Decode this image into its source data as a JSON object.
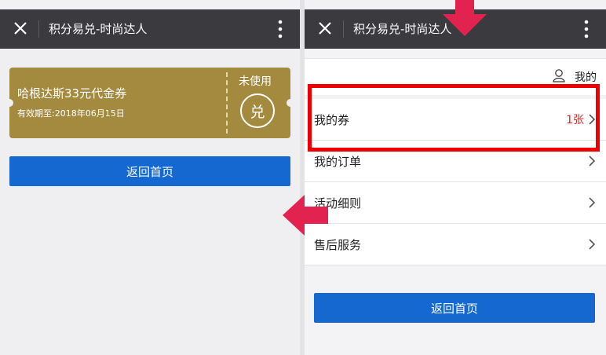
{
  "left": {
    "header": {
      "title": "积分易兑-时尚达人"
    },
    "coupon": {
      "title": "哈根达斯33元代金券",
      "expiry": "有效期至:2018年06月15日",
      "status": "未使用",
      "stamp": "兑"
    },
    "home_button": "返回首页"
  },
  "right": {
    "header": {
      "title": "积分易兑-时尚达人"
    },
    "user_label": "我的",
    "menu": [
      {
        "label": "我的券",
        "count": "1张"
      },
      {
        "label": "我的订单"
      },
      {
        "label": "活动细则"
      },
      {
        "label": "售后服务"
      }
    ],
    "home_button": "返回首页"
  },
  "colors": {
    "header_bg": "#3a3a3f",
    "coupon_gold": "#a48a3f",
    "button_blue": "#1468cf",
    "count_red": "#e0261d",
    "highlight_red": "#ee0000",
    "arrow_pink": "#e3234f"
  }
}
